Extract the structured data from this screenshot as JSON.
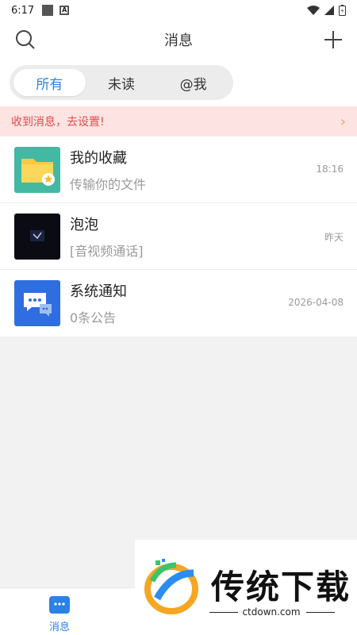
{
  "status_bar": {
    "time": "6:17",
    "notif_a": "A"
  },
  "header": {
    "title": "消息"
  },
  "segments": [
    {
      "label": "所有",
      "active": true
    },
    {
      "label": "未读",
      "active": false
    },
    {
      "label": "@我",
      "active": false
    }
  ],
  "banner": {
    "text": "收到消息，去设置!",
    "chevron": "›"
  },
  "conversations": [
    {
      "name": "我的收藏",
      "preview": "传输你的文件",
      "time": "18:16",
      "icon": "folder-star-icon",
      "color": "#43b9a4"
    },
    {
      "name": "泡泡",
      "preview": "[音视频通话]",
      "time": "昨天",
      "icon": "bubble-avatar",
      "color": "#0b0b14"
    },
    {
      "name": "系统通知",
      "preview": "0条公告",
      "time": "2026-04-08",
      "icon": "chat-bubbles-icon",
      "color": "#2f6ee0"
    }
  ],
  "tabbar": {
    "messages_label": "消息"
  },
  "watermark": {
    "brand": "传统下载",
    "url": "ctdown.com"
  },
  "colors": {
    "accent": "#2a82e4",
    "banner_bg": "#fde4e2",
    "banner_text": "#e34b4b"
  }
}
